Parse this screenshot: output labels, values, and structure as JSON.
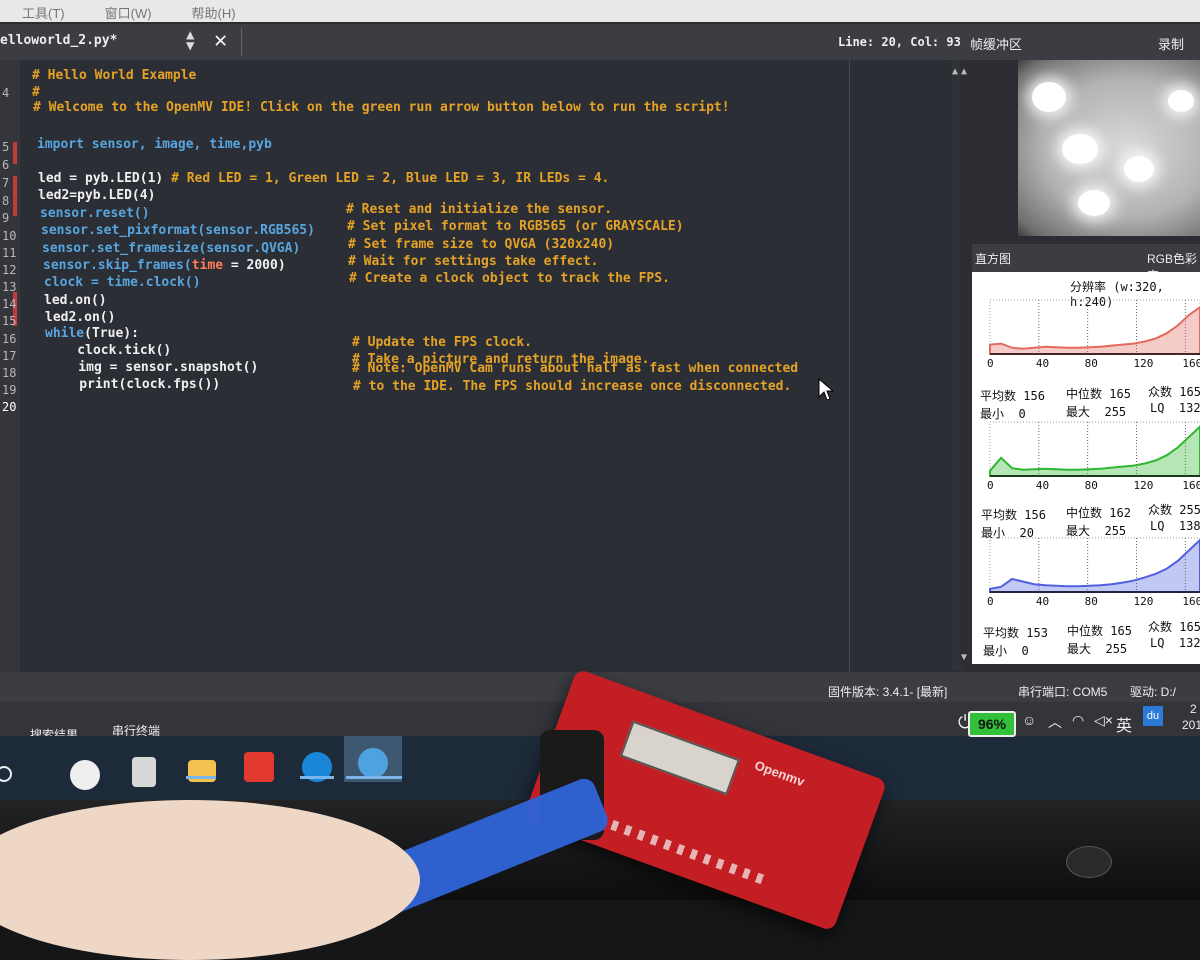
{
  "menu": [
    "工具(T)",
    "窗口(W)",
    "帮助(H)"
  ],
  "editor": {
    "file_tab": "elloworld_2.py*",
    "cursor_position": "Line: 20, Col: 93",
    "line_numbers": [
      "4",
      "5",
      "6",
      "7",
      "8",
      "9",
      "10",
      "11",
      "12",
      "13",
      "14",
      "15",
      "16",
      "17",
      "18",
      "19",
      "20"
    ],
    "lines": [
      {
        "comment": "# Hello World Example"
      },
      {
        "comment": "#"
      },
      {
        "comment": "# Welcome to the OpenMV IDE! Click on the green run arrow button below to run the script!"
      },
      {
        "keyword": "import",
        "text": " sensor, image, time,pyb"
      },
      {
        "code": "led = pyb.LED(1)",
        "comment": "# Red LED = 1, Green LED = 2, Blue LED = 3, IR LEDs = 4."
      },
      {
        "code": "led2=pyb.LED(4)"
      },
      {
        "code": "sensor.reset()",
        "comment": "# Reset and initialize the sensor."
      },
      {
        "code": "sensor.set_pixformat(sensor.RGB565)",
        "comment": "# Set pixel format to RGB565 (or GRAYSCALE)"
      },
      {
        "code": "sensor.set_framesize(sensor.QVGA)",
        "comment": "# Set frame size to QVGA (320x240)"
      },
      {
        "code_pre": "sensor.skip_frames(",
        "code_kw": "time",
        "code_post": " = 2000)",
        "comment": "# Wait for settings take effect."
      },
      {
        "code": "clock = time.clock()",
        "comment": "# Create a clock object to track the FPS."
      },
      {
        "code": "led.on()"
      },
      {
        "code": "led2.on()"
      },
      {
        "keyword": "while",
        "text": "(True):"
      },
      {
        "code": "    clock.tick()",
        "comment": "# Update the FPS clock."
      },
      {
        "code": "    img = sensor.snapshot()",
        "comment": "# Take a picture and return the image."
      },
      {
        "code": "    print(clock.fps())",
        "comment": "# Note: OpenMV Cam runs about half as fast when connected"
      },
      {
        "comment2": "# to the IDE. The FPS should increase once disconnected."
      }
    ]
  },
  "frame_buffer": {
    "title": "帧缓冲区",
    "record": "录制"
  },
  "histogram": {
    "title": "直方图",
    "color_space": "RGB色彩空",
    "resolution": "分辨率 (w:320, h:240)",
    "axis_ticks": [
      "0",
      "40",
      "80",
      "120",
      "160"
    ],
    "channels": [
      {
        "channel": "R",
        "color": "#e36a5e",
        "mean": "156",
        "median": "165",
        "mode": "165",
        "min": "0",
        "max": "255",
        "lq": "132"
      },
      {
        "channel": "G",
        "color": "#2fb72f",
        "mean": "156",
        "median": "162",
        "mode": "255",
        "min": "20",
        "max": "255",
        "lq": "138"
      },
      {
        "channel": "B",
        "color": "#5060e0",
        "mean": "153",
        "median": "165",
        "mode": "165",
        "min": "0",
        "max": "255",
        "lq": "132"
      }
    ],
    "labels": {
      "mean": "平均数",
      "median": "中位数",
      "mode": "众数",
      "min": "最小",
      "max": "最大",
      "lq": "LQ"
    }
  },
  "status": {
    "firmware": "固件版本: 3.4.1- [最新]",
    "serial": "串行端口: COM5",
    "drive": "驱动: D:/"
  },
  "bottom_tabs": [
    "搜索结果",
    "串行终端"
  ],
  "tray": {
    "battery": "96%",
    "ime": "英",
    "baidu": "du",
    "clock": "2",
    "year": "201"
  },
  "board_label": "Openmv"
}
